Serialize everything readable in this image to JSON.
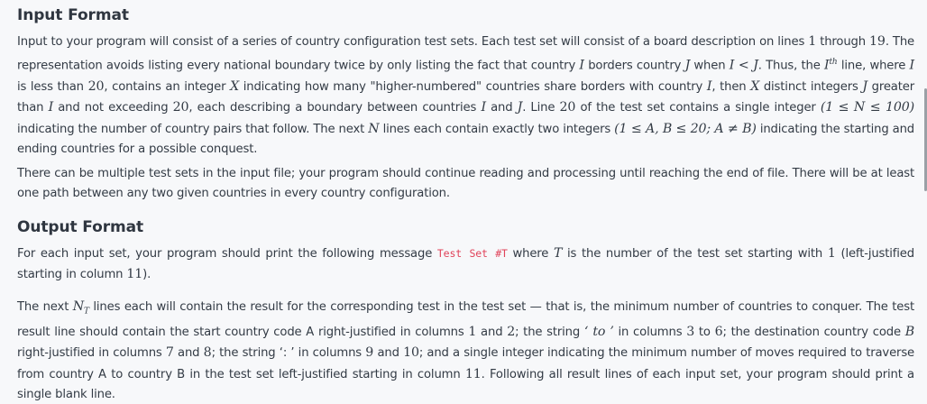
{
  "input_section": {
    "heading": "Input Format",
    "paragraph1": {
      "a": "Input to your program will consist of a series of country configuration test sets. Each test set will consist of a board description on lines ",
      "one": "1",
      "b": " through ",
      "nineteen": "19",
      "c": ". The representation avoids listing every national boundary twice by only listing the fact that country ",
      "I1": "I",
      "d": " borders country ",
      "J1": "J",
      "e": " when ",
      "ineq": "I < J",
      "f": ". Thus, the ",
      "ith": "I",
      "ith_sup": "th",
      "g": " line, where ",
      "I2": "I",
      "h": " is less than ",
      "twenty1": "20",
      "i": ", contains an integer ",
      "X1": "X",
      "j": " indicating how many \"higher-numbered\" countries share borders with country ",
      "I3": "I",
      "k": ", then ",
      "X2": "X",
      "l": " distinct integers ",
      "J2": "J",
      "m": " greater than ",
      "I4": "I",
      "n": " and not exceeding ",
      "twenty2": "20",
      "o": ", each describing a boundary between countries ",
      "I5": "I",
      "p": " and ",
      "J3": "J",
      "q": ". Line ",
      "twenty3": "20",
      "r": " of the test set contains a single integer ",
      "nrange": "(1 ≤ N ≤ 100)",
      "s": " indicating the number of country pairs that follow. The next ",
      "N": "N",
      "t": " lines each contain exactly two integers ",
      "abrange": "(1 ≤ A, B ≤ 20; A ≠ B)",
      "u": " indicating the starting and ending countries for a possible conquest."
    },
    "paragraph2": "There can be multiple test sets in the input file; your program should continue reading and processing until reaching the end of file. There will be at least one path between any two given countries in every country configuration."
  },
  "output_section": {
    "heading": "Output Format",
    "paragraph3": {
      "a": "For each input set, your program should print the following message ",
      "code": "Test Set #T",
      "b": " where ",
      "T": "T",
      "c": " is the number of the test set starting with ",
      "one": "1",
      "d": " (left-justified starting in column ",
      "eleven": "11",
      "e": ")."
    },
    "paragraph4": {
      "a": "The next ",
      "NT": "N",
      "NT_sub": "T",
      "b": " lines each will contain the result for the corresponding test in the test set — that is, the minimum number of countries to conquer. The test result line should contain the start country code A right-justified in columns ",
      "one": "1",
      "c": " and ",
      "two": "2",
      "d": "; the string ",
      "to": "‘ to ’",
      "e": " in columns ",
      "three": "3",
      "f": " to ",
      "six": "6",
      "g": "; the destination country code ",
      "B": "B",
      "h": " right-justified in columns ",
      "seven": "7",
      "i": " and ",
      "eight": "8",
      "j": "; the string ‘: ’ in columns ",
      "nine": "9",
      "k": " and ",
      "ten": "10",
      "l": "; and a single integer indicating the minimum number of moves required to traverse from country A to country B in the test set left-justified starting in column ",
      "eleven": "11",
      "m": ". Following all result lines of each input set, your program should print a single blank line."
    }
  },
  "colors": {
    "background": "#f7f8fa",
    "text": "#333b45",
    "code": "#e0435a"
  }
}
